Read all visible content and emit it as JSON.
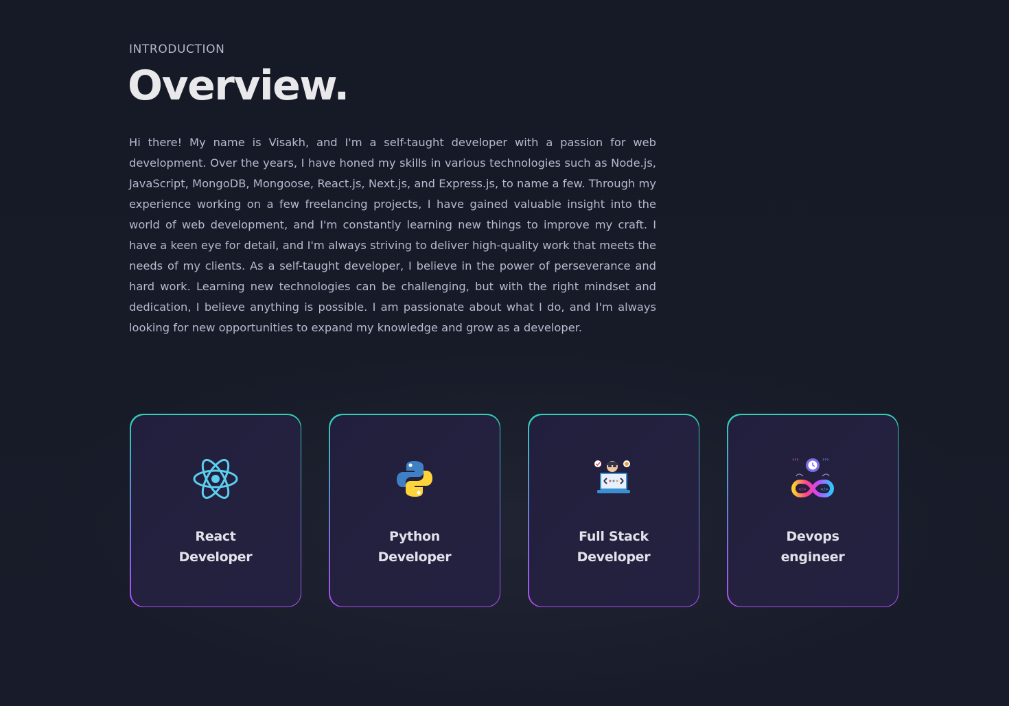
{
  "section": {
    "eyebrow": "INTRODUCTION",
    "title": "Overview.",
    "description": "Hi there! My name is Visakh, and I'm a self-taught developer with a passion for web development. Over the years, I have honed my skills in various technologies such as Node.js, JavaScript, MongoDB, Mongoose, React.js, Next.js, and Express.js, to name a few. Through my experience working on a few freelancing projects, I have gained valuable insight into the world of web development, and I'm constantly learning new things to improve my craft. I have a keen eye for detail, and I'm always striving to deliver high-quality work that meets the needs of my clients. As a self-taught developer, I believe in the power of perseverance and hard work. Learning new technologies can be challenging, but with the right mindset and dedication, I believe anything is possible. I am passionate about what I do, and I'm always looking for new opportunities to expand my knowledge and grow as a developer."
  },
  "cards": [
    {
      "title": "React Developer",
      "icon": "react-icon"
    },
    {
      "title": "Python Developer",
      "icon": "python-icon"
    },
    {
      "title": "Full Stack Developer",
      "icon": "full-stack-developer-icon"
    },
    {
      "title": "Devops engineer",
      "icon": "devops-infinity-icon"
    }
  ],
  "colors": {
    "background": "#161a27",
    "card_background": "#221f3e",
    "card_border_top": "#2fd3b5",
    "card_border_bottom": "#b14bf4",
    "heading_text": "#e9e9ec",
    "body_text": "#b9b8cf"
  }
}
